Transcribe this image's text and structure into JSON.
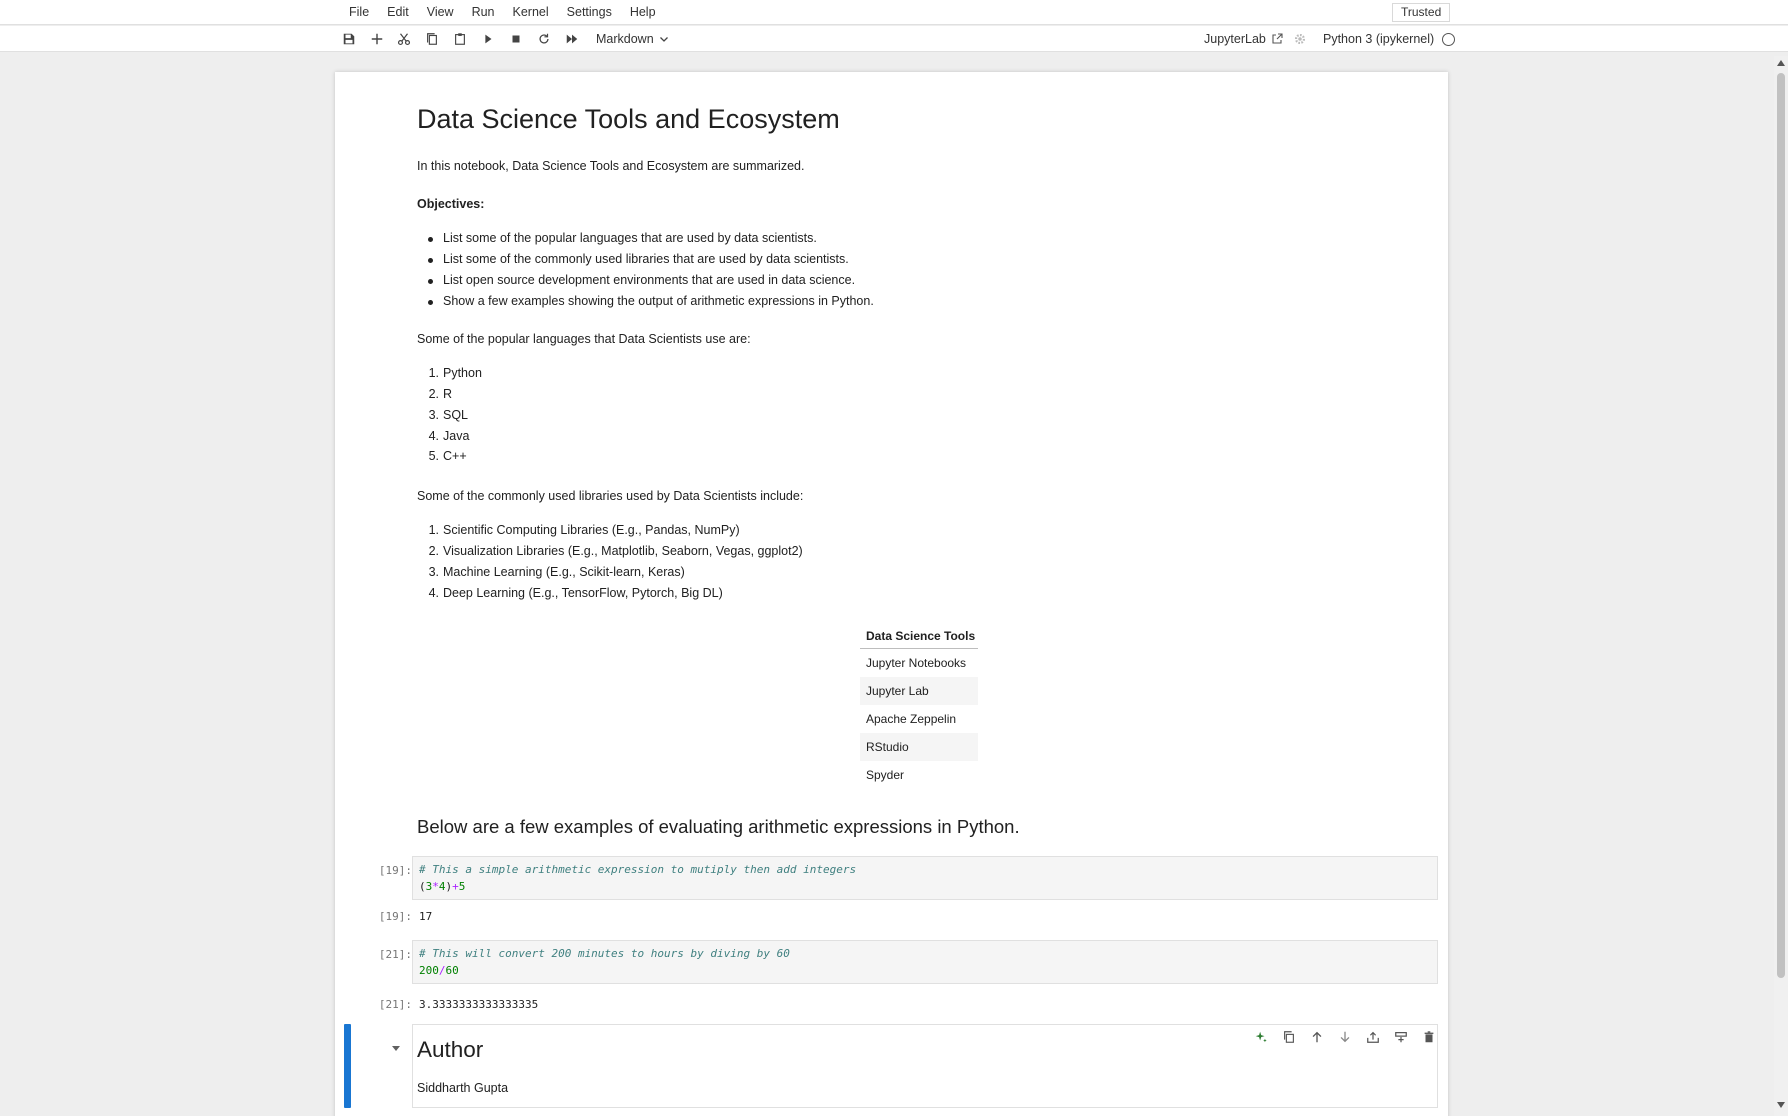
{
  "menubar": {
    "items": [
      "File",
      "Edit",
      "View",
      "Run",
      "Kernel",
      "Settings",
      "Help"
    ],
    "trusted": "Trusted"
  },
  "toolbar": {
    "buttons": [
      "save-icon",
      "add-cell-icon",
      "cut-icon",
      "copy-icon",
      "paste-icon",
      "run-icon",
      "stop-icon",
      "restart-icon",
      "run-all-icon"
    ],
    "cell_type": "Markdown",
    "jupyterlab_link": "JupyterLab",
    "kernel_name": "Python 3 (ipykernel)"
  },
  "notebook": {
    "title": "Data Science Tools and Ecosystem",
    "intro": "In this notebook, Data Science Tools and Ecosystem are summarized.",
    "objectives_label": "Objectives:",
    "objectives": [
      "List some of the popular languages that are used by data scientists.",
      "List some of the commonly used libraries that are used by data scientists.",
      "List open source development environments that are used in data science.",
      "Show a few examples showing the output of arithmetic expressions in Python."
    ],
    "languages_intro": "Some of the popular languages that Data Scientists use are:",
    "languages": [
      "Python",
      "R",
      "SQL",
      "Java",
      "C++"
    ],
    "libraries_intro": "Some of the commonly used libraries used by Data Scientists include:",
    "libraries": [
      "Scientific Computing Libraries (E.g., Pandas, NumPy)",
      "Visualization Libraries (E.g., Matplotlib, Seaborn, Vegas, ggplot2)",
      "Machine Learning (E.g., Scikit-learn, Keras)",
      "Deep Learning (E.g., TensorFlow, Pytorch, Big DL)"
    ],
    "tools_table": {
      "header": "Data Science Tools",
      "rows": [
        "Jupyter Notebooks",
        "Jupyter Lab",
        "Apache Zeppelin",
        "RStudio",
        "Spyder"
      ]
    },
    "arith_heading": "Below are a few examples of evaluating arithmetic expressions in Python.",
    "cells": [
      {
        "prompt": "[19]:",
        "comment": "# This a simple arithmetic expression to mutiply then add integers",
        "code": {
          "p1": "(",
          "a": "3",
          "op1": "*",
          "b": "4",
          "p2": ")",
          "op2": "+",
          "c": "5"
        },
        "out_prompt": "[19]:",
        "output": "17"
      },
      {
        "prompt": "[21]:",
        "comment": "# This will convert 200 minutes to hours by diving by 60",
        "code": {
          "a": "200",
          "op1": "/",
          "b": "60"
        },
        "out_prompt": "[21]:",
        "output": "3.3333333333333335"
      }
    ],
    "author_heading": "Author",
    "author_name": "Siddharth Gupta",
    "cell_tools": [
      "ai-sparkle-icon",
      "duplicate-icon",
      "move-up-icon",
      "move-down-icon",
      "insert-above-icon",
      "insert-below-icon",
      "delete-icon"
    ]
  }
}
